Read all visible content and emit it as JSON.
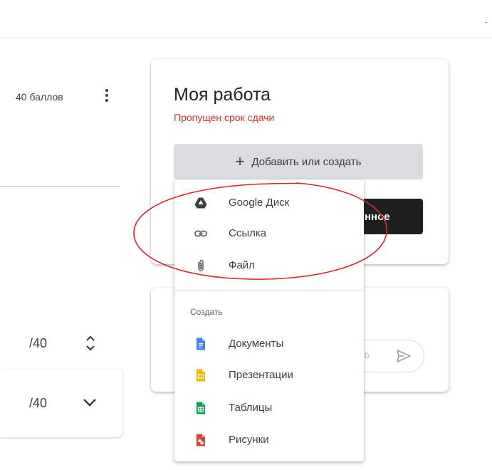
{
  "page": {
    "corner_mark": "-"
  },
  "assignment": {
    "points": "40 баллов",
    "grade_1": "/40",
    "grade_2": "/40"
  },
  "my_work": {
    "title": "Моя работа",
    "status": "Пропущен срок сдачи",
    "add_button": "Добавить или создать",
    "done_button_partial": "нное"
  },
  "comments": {
    "placeholder_partial": "ib"
  },
  "add_menu": {
    "attach_items": [
      {
        "label": "Google Диск",
        "icon": "google-drive-icon"
      },
      {
        "label": "Ссылка",
        "icon": "link-icon"
      },
      {
        "label": "Файл",
        "icon": "paperclip-icon"
      }
    ],
    "create_section_title": "Создать",
    "create_items": [
      {
        "label": "Документы",
        "icon": "google-docs-icon"
      },
      {
        "label": "Презентации",
        "icon": "google-slides-icon"
      },
      {
        "label": "Таблицы",
        "icon": "google-sheets-icon"
      },
      {
        "label": "Рисунки",
        "icon": "google-drawings-icon"
      }
    ]
  },
  "colors": {
    "status_red": "#d93025",
    "annotation_red": "#d6262b",
    "docs_blue": "#4285f4",
    "slides_yellow": "#f4b400",
    "sheets_green": "#0f9d58",
    "drawings_red": "#db4437"
  }
}
